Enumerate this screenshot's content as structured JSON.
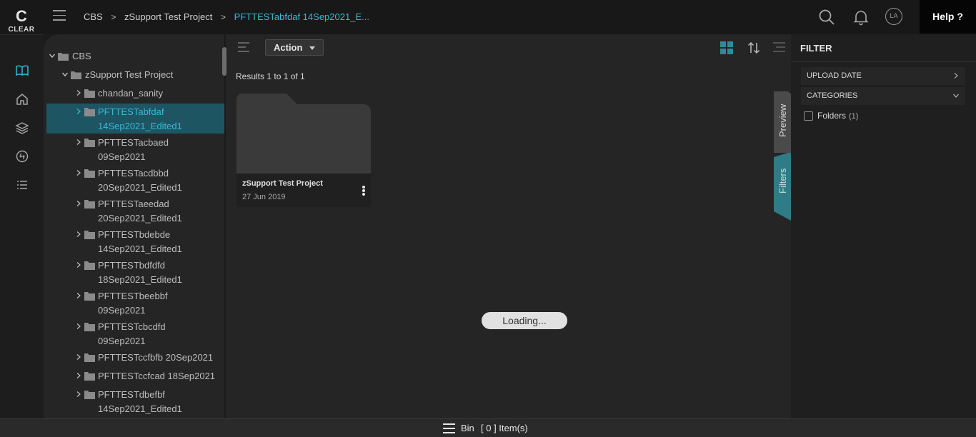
{
  "app": {
    "logo_glyph": "C",
    "logo_text": "CLEAR"
  },
  "breadcrumb": {
    "items": [
      "CBS",
      "zSupport Test Project",
      "PFTTESTabfdaf 14Sep2021_E..."
    ]
  },
  "header": {
    "avatar_initials": "LA",
    "help_label": "Help ?"
  },
  "tree": {
    "root": "CBS",
    "project": "zSupport Test Project",
    "folders": [
      {
        "line1": "chandan_sanity",
        "line2": ""
      },
      {
        "line1": "PFTTESTabfdaf",
        "line2": "14Sep2021_Edited1"
      },
      {
        "line1": "PFTTESTacbaed",
        "line2": "09Sep2021"
      },
      {
        "line1": "PFTTESTacdbbd",
        "line2": "20Sep2021_Edited1"
      },
      {
        "line1": "PFTTESTaeedad",
        "line2": "20Sep2021_Edited1"
      },
      {
        "line1": "PFTTESTbdebde",
        "line2": "14Sep2021_Edited1"
      },
      {
        "line1": "PFTTESTbdfdfd",
        "line2": "18Sep2021_Edited1"
      },
      {
        "line1": "PFTTESTbeebbf",
        "line2": "09Sep2021"
      },
      {
        "line1": "PFTTESTcbcdfd",
        "line2": "09Sep2021"
      },
      {
        "line1": "PFTTESTccfbfb 20Sep2021",
        "line2": ""
      },
      {
        "line1": "PFTTESTccfcad 18Sep2021",
        "line2": ""
      },
      {
        "line1": "PFTTESTdbefbf",
        "line2": "14Sep2021_Edited1"
      }
    ]
  },
  "toolbar": {
    "action_label": "Action"
  },
  "results": {
    "summary": "Results 1 to 1 of 1"
  },
  "card": {
    "title": "zSupport Test Project",
    "date": "27 Jun 2019"
  },
  "loading": {
    "text": "Loading..."
  },
  "side_tabs": {
    "preview": "Preview",
    "filters": "Filters"
  },
  "filter": {
    "heading": "FILTER",
    "facets": [
      "UPLOAD DATE",
      "CATEGORIES"
    ],
    "option_label": "Folders",
    "option_count": "(1)"
  },
  "bin": {
    "label": "Bin",
    "count_text": "[ 0 ] Item(s)"
  },
  "colors": {
    "accent": "#39b7d6",
    "selection": "#1e5563",
    "preview_tab": "#4a4a4a",
    "filters_tab": "#2e7c87",
    "view_active": "#2e8c9a"
  }
}
